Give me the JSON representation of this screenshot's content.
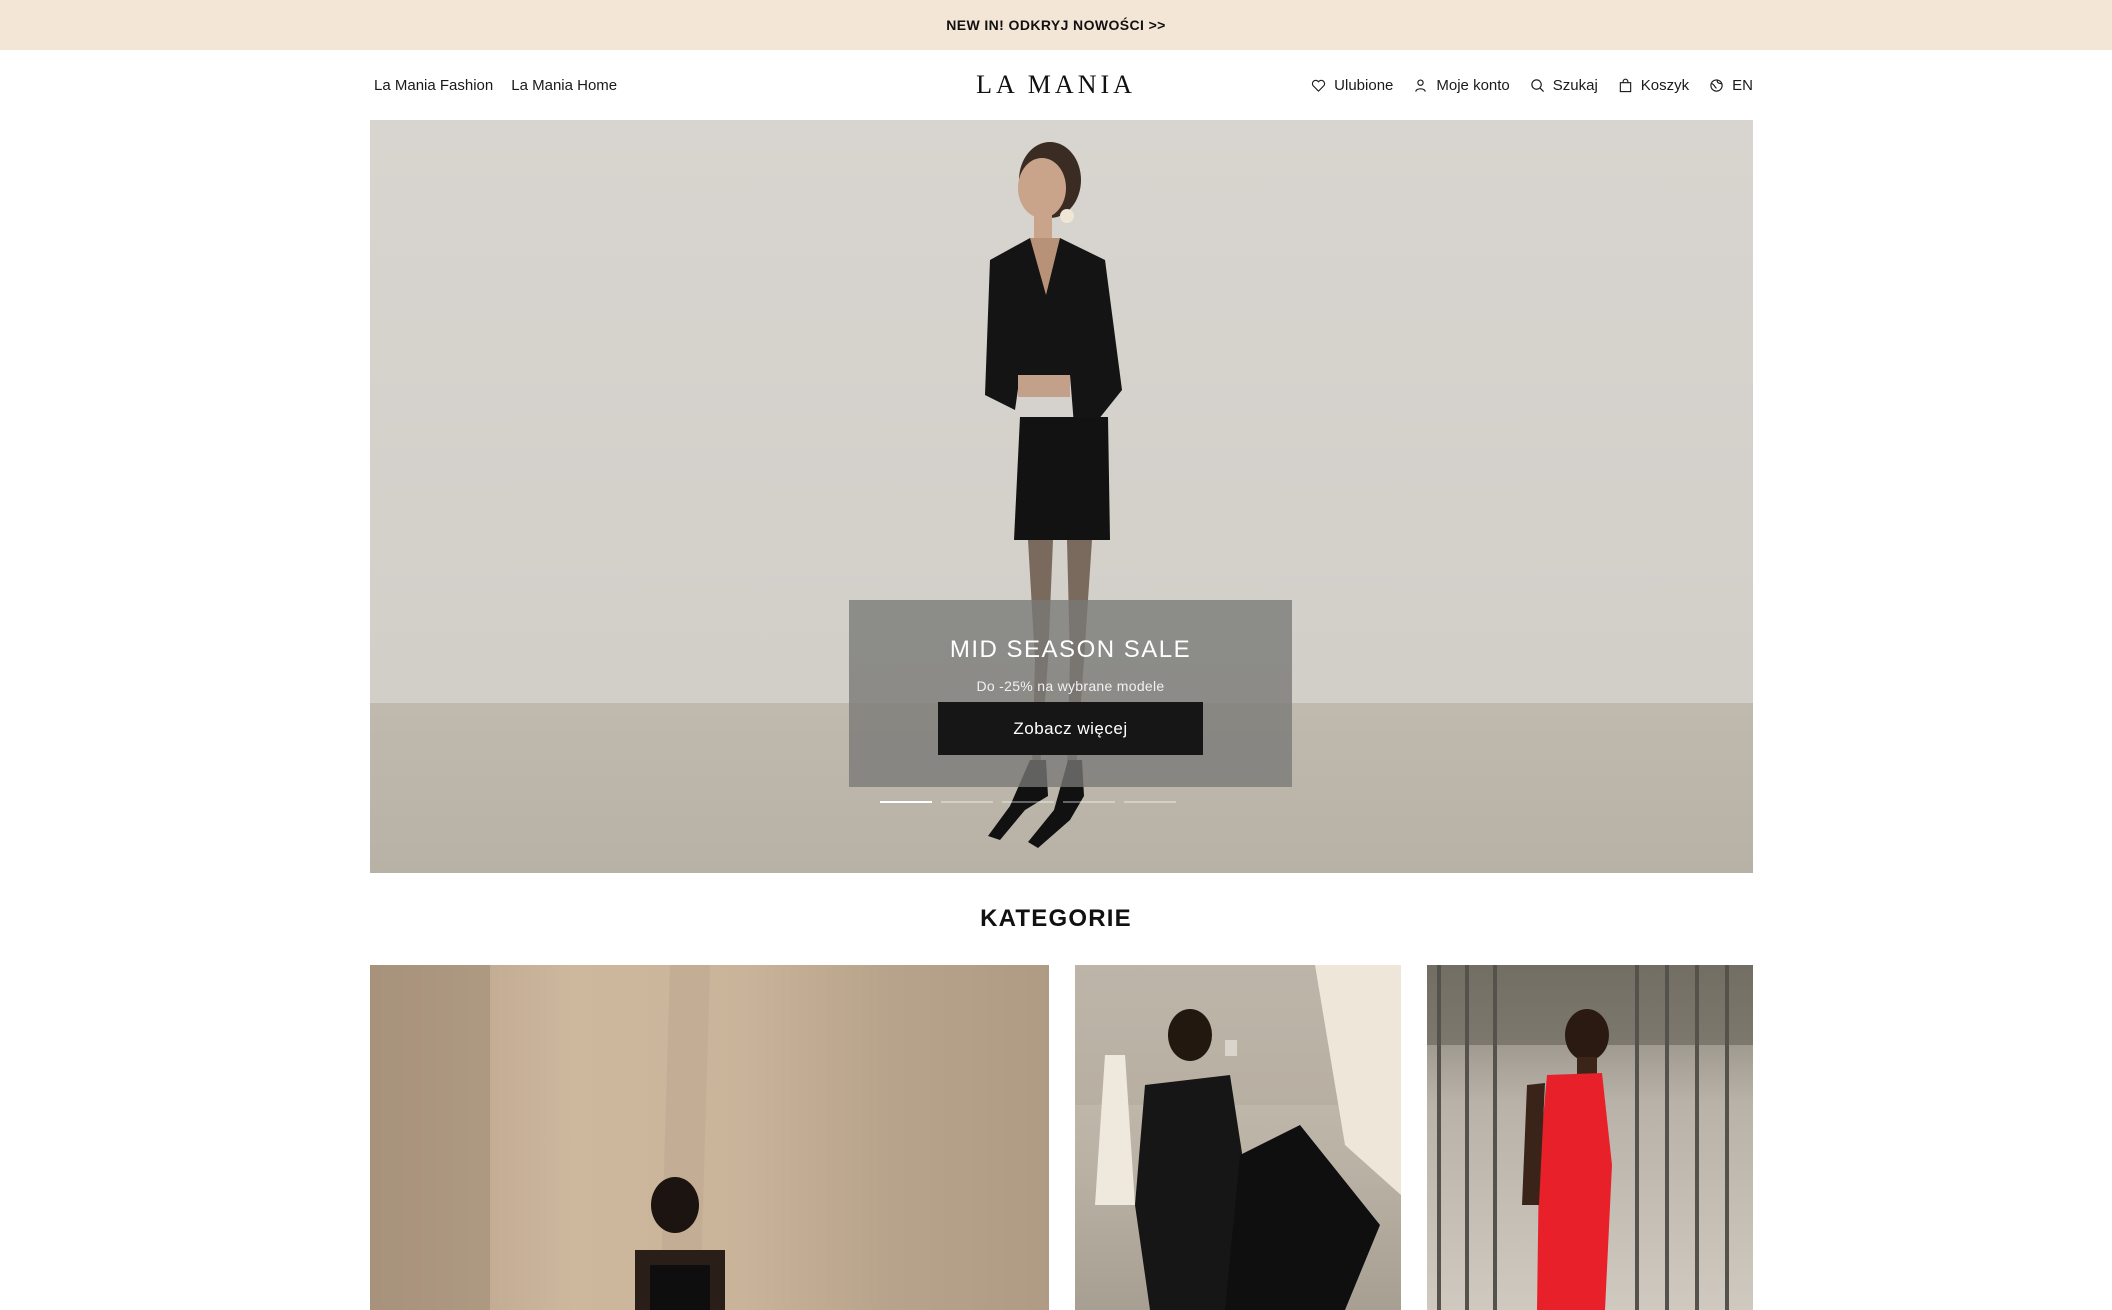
{
  "promo": {
    "text": "NEW IN! ODKRYJ NOWOŚCI >>"
  },
  "header": {
    "left_links": [
      "La Mania Fashion",
      "La Mania Home"
    ],
    "logo": "LA MANIA",
    "right_links": {
      "favorites": "Ulubione",
      "account": "Moje konto",
      "search": "Szukaj",
      "cart": "Koszyk",
      "language": "EN"
    }
  },
  "hero": {
    "title": "MID SEASON SALE",
    "subtitle": "Do -25% na wybrane modele",
    "cta": "Zobacz więcej",
    "slides_count": 5,
    "active_slide": 1
  },
  "categories": {
    "title": "KATEGORIE"
  },
  "colors": {
    "promo_bg": "#f4e6d7",
    "cta_bg": "#161616",
    "hero_bg": "#d6d2cc"
  },
  "icons": [
    "heart-icon",
    "user-icon",
    "search-icon",
    "bag-icon",
    "globe-icon"
  ]
}
